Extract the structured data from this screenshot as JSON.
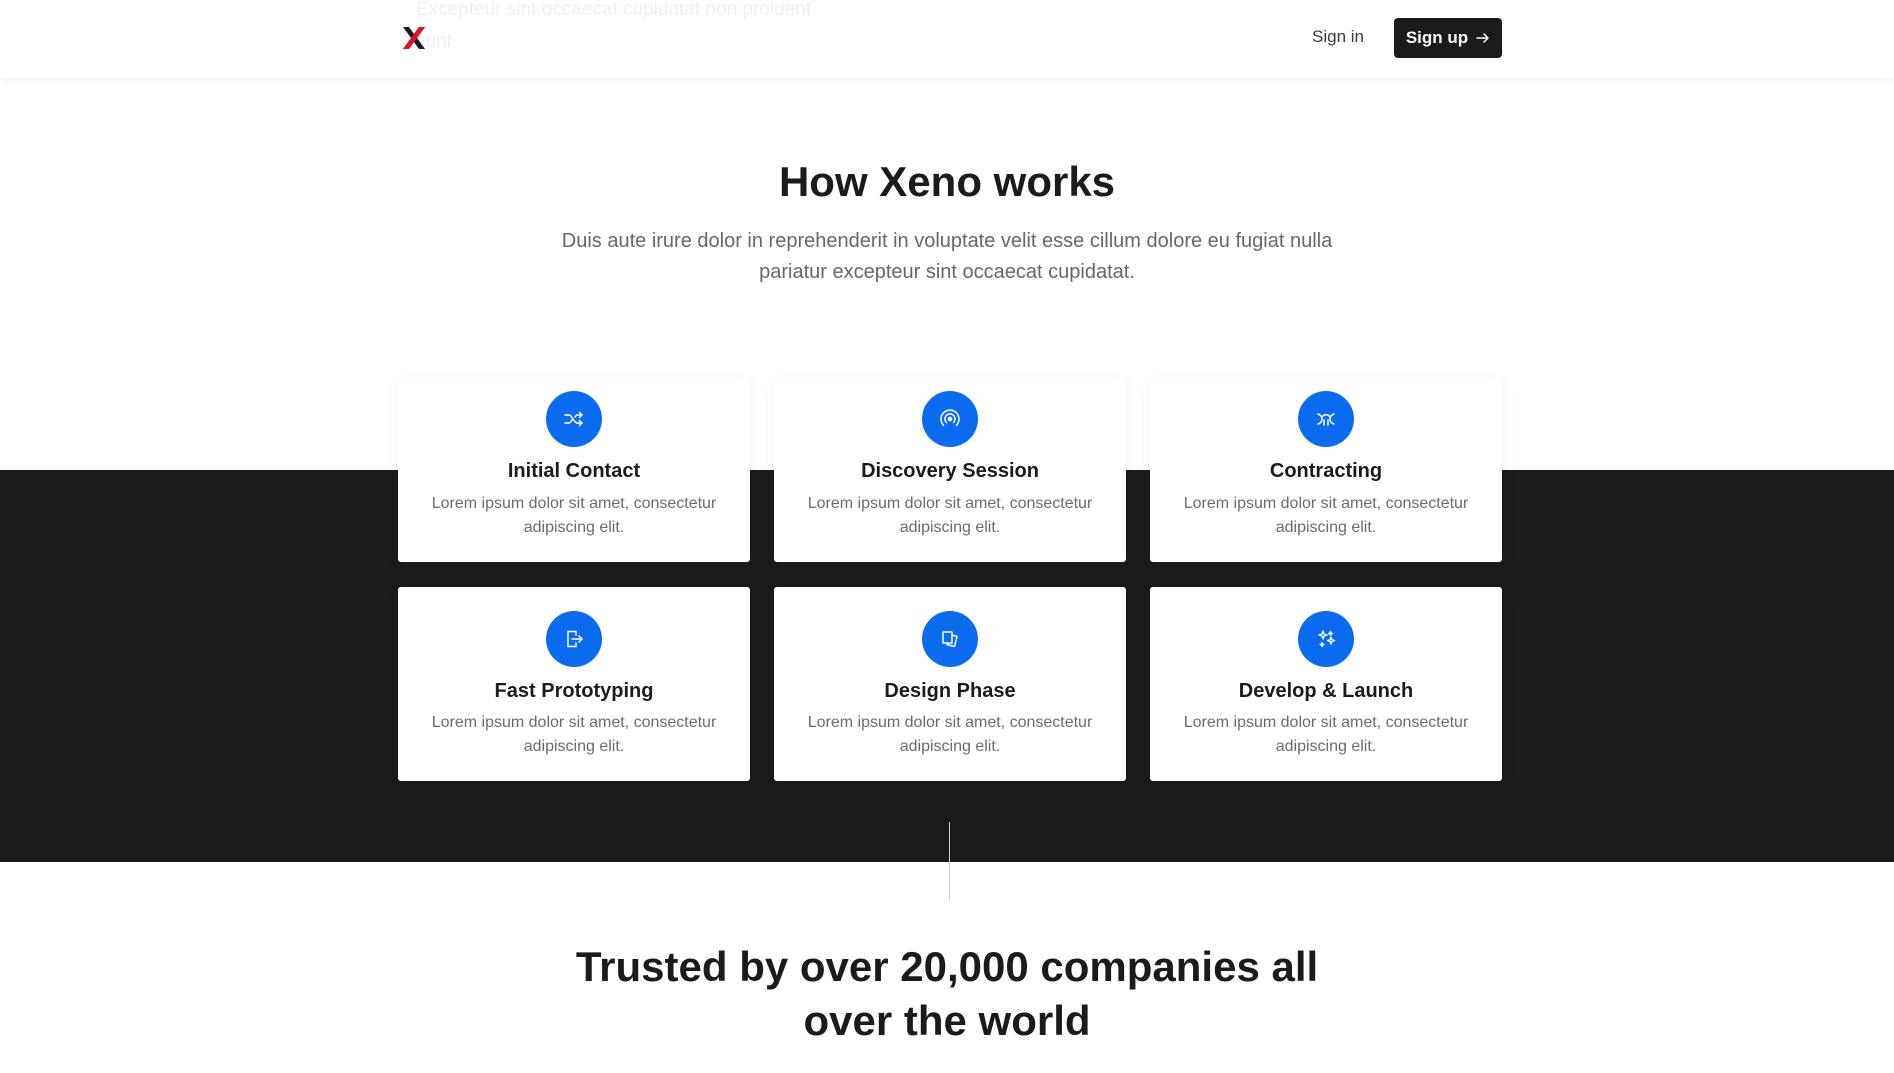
{
  "header": {
    "faded_text": "Excepteur sint occaecat cupidatat non proident sunt",
    "signin_label": "Sign in",
    "signup_label": "Sign up"
  },
  "intro": {
    "title": "How Xeno works",
    "description": "Duis aute irure dolor in reprehenderit in voluptate velit esse cillum dolore eu fugiat nulla pariatur excepteur sint occaecat cupidatat."
  },
  "cards": [
    {
      "icon": "shuffle-icon",
      "title": "Initial Contact",
      "description": "Lorem ipsum dolor sit amet, consectetur adipiscing elit."
    },
    {
      "icon": "broadcast-icon",
      "title": "Discovery Session",
      "description": "Lorem ipsum dolor sit amet, consectetur adipiscing elit."
    },
    {
      "icon": "handshake-icon",
      "title": "Contracting",
      "description": "Lorem ipsum dolor sit amet, consectetur adipiscing elit."
    },
    {
      "icon": "box-arrow-right-icon",
      "title": "Fast Prototyping",
      "description": "Lorem ipsum dolor sit amet, consectetur adipiscing elit."
    },
    {
      "icon": "layers-icon",
      "title": "Design Phase",
      "description": "Lorem ipsum dolor sit amet, consectetur adipiscing elit."
    },
    {
      "icon": "sparkles-icon",
      "title": "Develop & Launch",
      "description": "Lorem ipsum dolor sit amet, consectetur adipiscing elit."
    }
  ],
  "trusted": {
    "title": "Trusted by over 20,000 companies all over the world"
  },
  "colors": {
    "accent": "#0b6cf0",
    "dark": "#1b1b1c",
    "logo_red": "#e8112d"
  }
}
